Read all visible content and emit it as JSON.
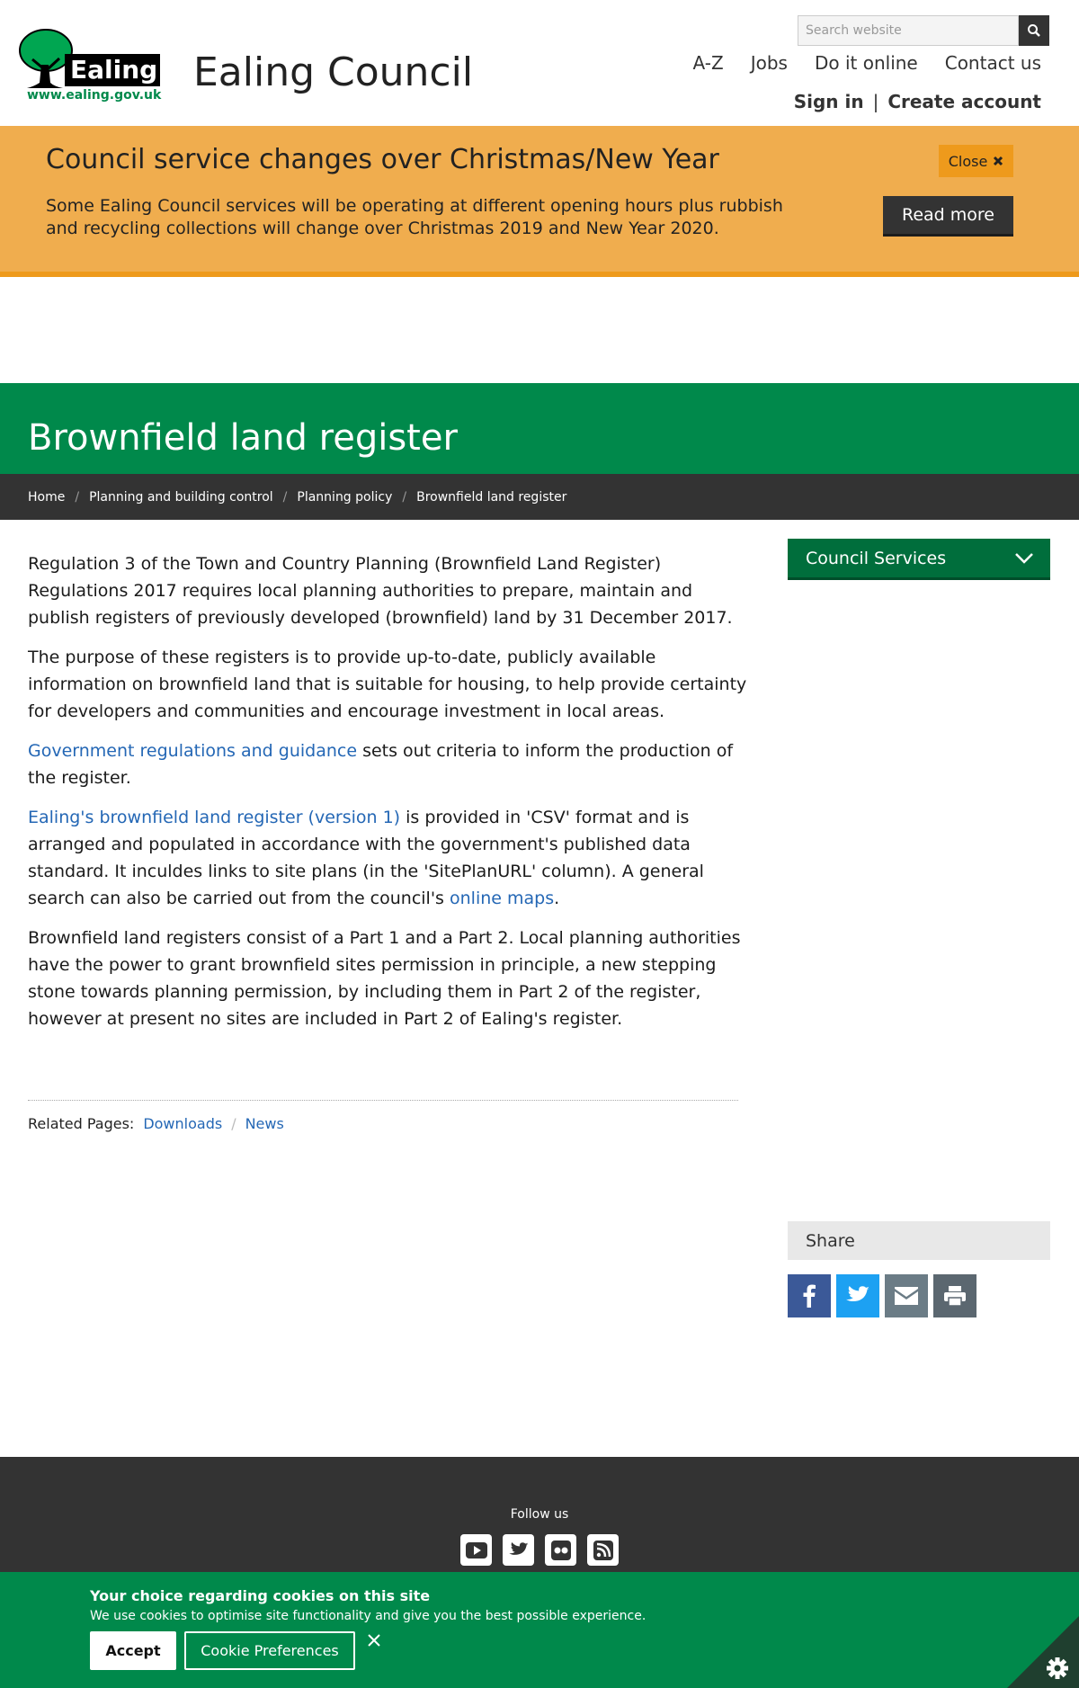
{
  "header": {
    "logo_text": "Ealing",
    "logo_url": "www.ealing.gov.uk",
    "site_name": "Ealing Council",
    "search_placeholder": "Search website",
    "nav": [
      "A-Z",
      "Jobs",
      "Do it online",
      "Contact us"
    ],
    "sign_in": "Sign in",
    "separator": "|",
    "create_account": "Create account"
  },
  "alert": {
    "title": "Council service changes over Christmas/New Year",
    "body": "Some Ealing Council services will be operating at different opening hours plus rubbish and recycling collections will change over Christmas 2019 and New Year 2020.",
    "close_label": "Close",
    "read_more_label": "Read more"
  },
  "page": {
    "title": "Brownfield land register",
    "breadcrumb": [
      "Home",
      "Planning and building control",
      "Planning policy",
      "Brownfield land register"
    ]
  },
  "content": {
    "p1": "Regulation 3 of the Town and Country Planning (Brownfield Land Register) Regulations 2017 requires local planning authorities to prepare, maintain and publish registers of previously developed (brownfield) land by 31 December 2017.",
    "p2": "The purpose of these registers is to provide up-to-date, publicly available information on brownfield land that is suitable for housing, to help provide certainty for developers and communities and encourage investment in local areas.",
    "p3_link": "Government regulations and guidance",
    "p3_text": " sets out criteria to inform the production of the register.",
    "p4_link": "Ealing's brownfield land register (version 1)",
    "p4_text": " is provided in 'CSV' format and is arranged and populated in accordance with the government's published data standard. It inculdes links to site plans (in the 'SitePlanURL' column). A general search can also be carried out from the council's ",
    "p4_link2": "online maps",
    "p4_end": ".",
    "p5": "Brownfield land registers consist of a Part 1 and a Part 2. Local planning authorities have the power to grant brownfield sites permission in principle, a new stepping stone towards planning permission, by including them in Part 2 of the register, however at present no sites are included in Part 2 of Ealing's register.",
    "related_label": "Related Pages:",
    "related_links": [
      "Downloads",
      "News"
    ],
    "related_sep": "/"
  },
  "sidebar": {
    "services_label": "Council Services",
    "share_label": "Share"
  },
  "footer": {
    "follow_label": "Follow us"
  },
  "cookie": {
    "title": "Your choice regarding cookies on this site",
    "text": "We use cookies to optimise site functionality and give you the best possible experience.",
    "accept_label": "Accept",
    "prefs_label": "Cookie Preferences"
  },
  "colors": {
    "brand_green": "#00894b",
    "alert_orange": "#f0ad4e",
    "link_blue": "#2467b5",
    "facebook": "#3b5998",
    "twitter": "#1da1f2",
    "email": "#6b7c86",
    "print": "#5b6770"
  }
}
